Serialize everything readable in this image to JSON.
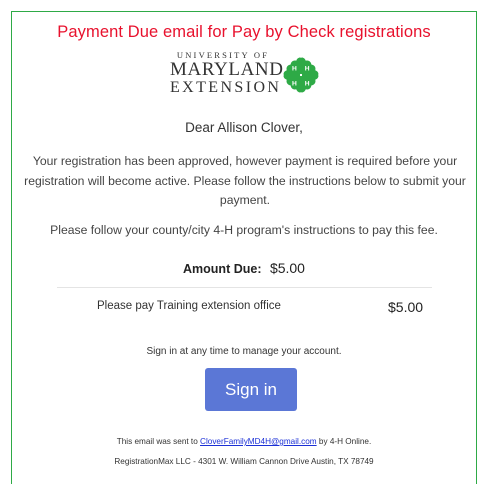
{
  "headline": "Payment Due email for Pay by Check registrations",
  "logo": {
    "line1": "UNIVERSITY OF",
    "line2": "MARYLAND",
    "line3": "EXTENSION",
    "clover_color": "#2eaa46"
  },
  "greeting": "Dear Allison Clover,",
  "body_text": "Your registration has been approved, however payment is required before your registration will become active. Please follow the instructions below to submit your payment.",
  "instructions": "Please follow your county/city 4-H program's instructions to pay this fee.",
  "amount_due": {
    "label": "Amount Due:",
    "value": "$5.00"
  },
  "line_item": {
    "label": "Please pay Training extension office",
    "amount": "$5.00"
  },
  "manage_text": "Sign in at any time to manage your account.",
  "signin_label": "Sign in",
  "footer": {
    "sent_prefix": "This email was sent to ",
    "email": "CloverFamilyMD4H@gmail.com",
    "sent_suffix": " by 4-H Online.",
    "address": "RegistrationMax LLC - 4301 W. William Cannon Drive Austin, TX 78749"
  },
  "colors": {
    "headline": "#e8112d",
    "border": "#2eaa46",
    "button": "#5b77d6",
    "link": "#1a2fd6"
  }
}
